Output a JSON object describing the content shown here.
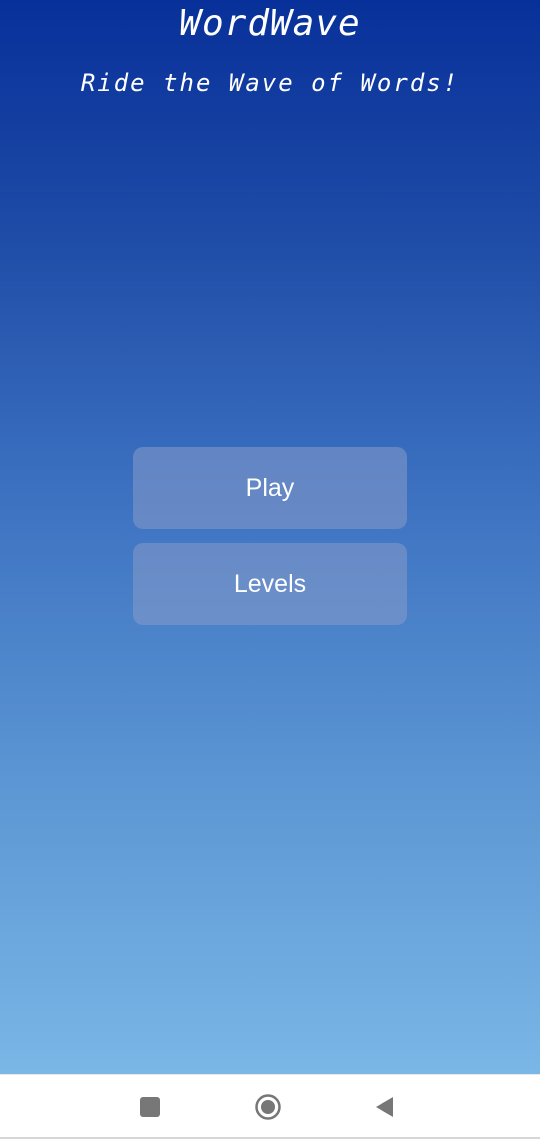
{
  "app": {
    "title": "WordWave",
    "subtitle": "Ride the Wave of Words!"
  },
  "menu": {
    "play_label": "Play",
    "levels_label": "Levels"
  },
  "navigation_bar": {
    "icons": [
      "recents-square-icon",
      "home-circle-icon",
      "back-triangle-icon"
    ],
    "icon_color": "#777777",
    "background": "#ffffff"
  },
  "colors": {
    "gradient_top": "#08309a",
    "gradient_bottom": "#7ab6e6",
    "button_fill": "#879bc8",
    "text": "#ffffff"
  }
}
